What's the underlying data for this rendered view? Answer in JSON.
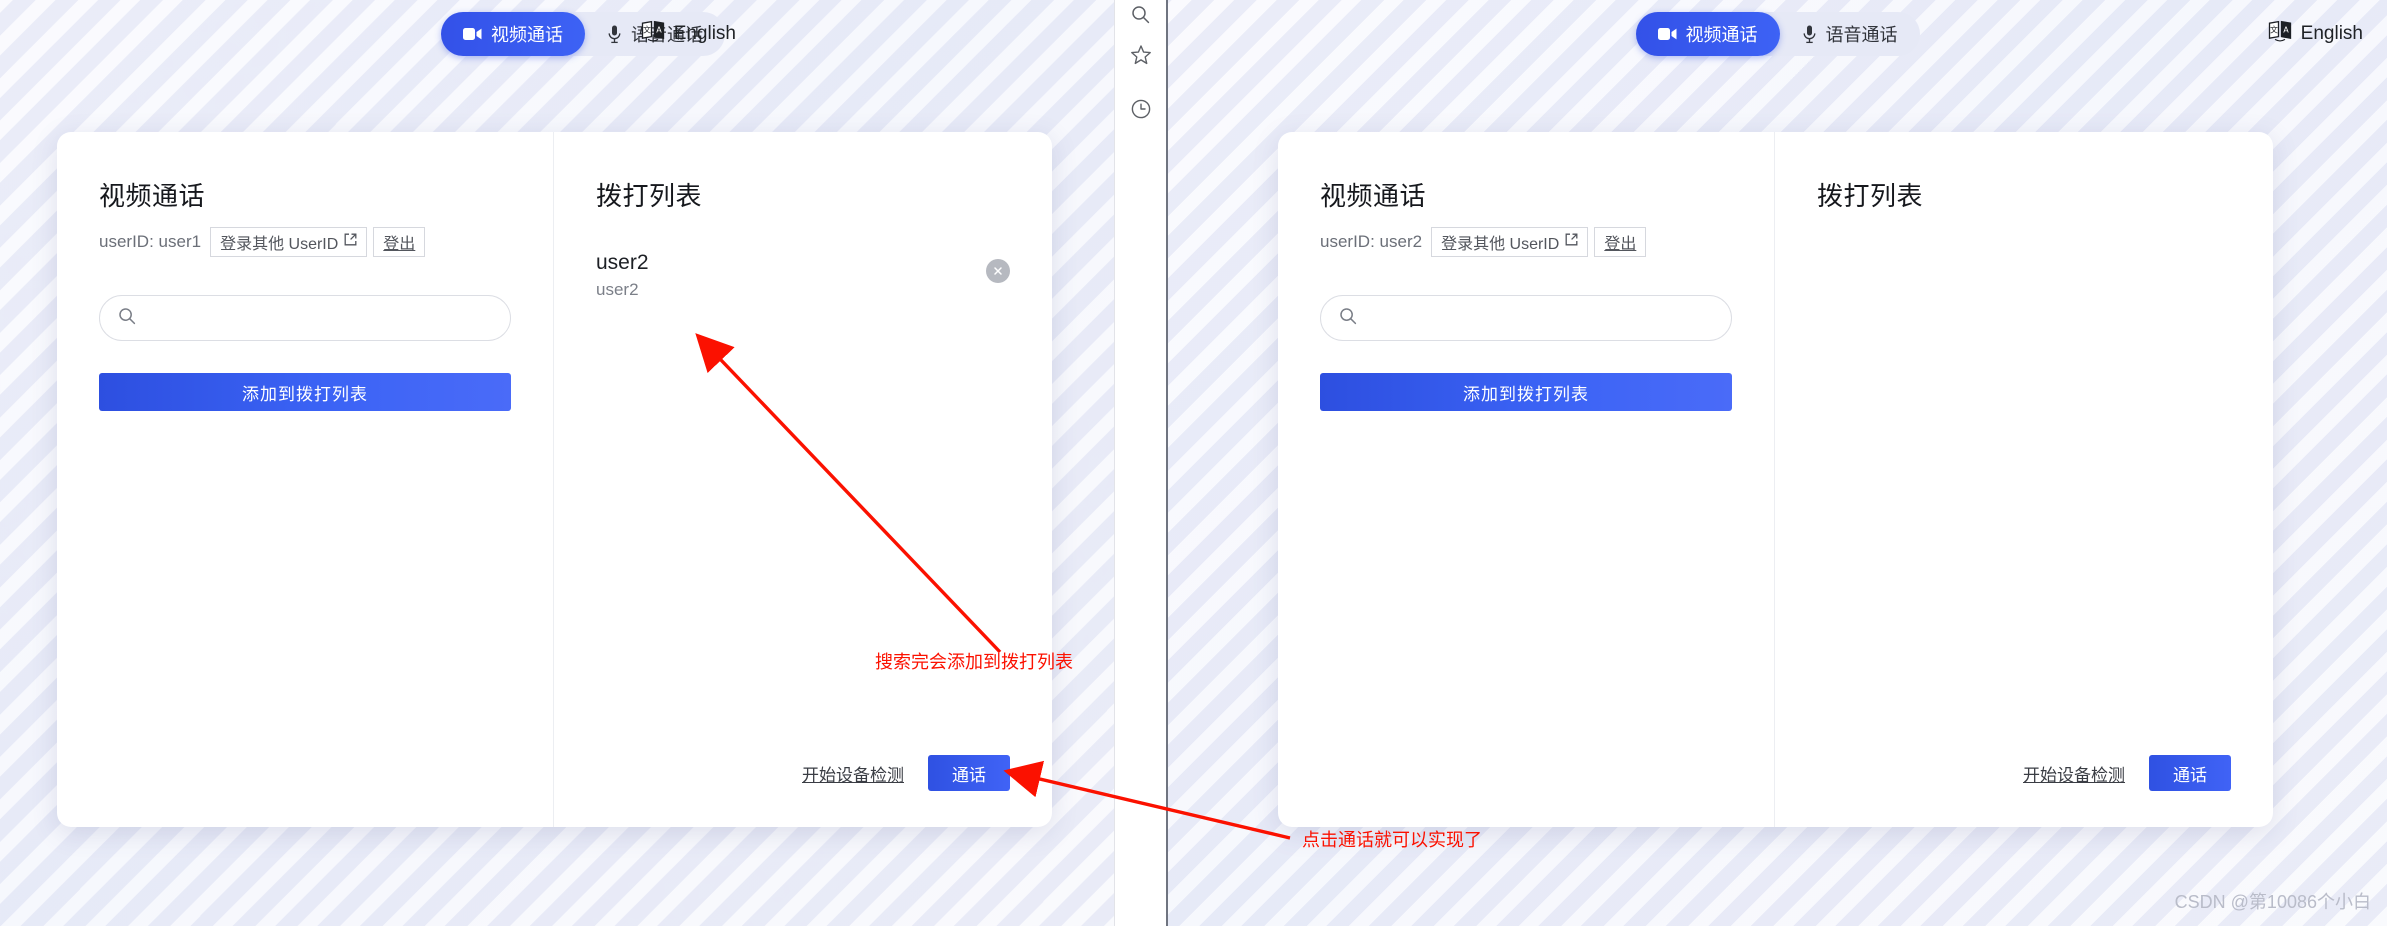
{
  "header": {
    "tabs": [
      {
        "label": "视频通话",
        "icon": "video-camera-icon",
        "active": true
      },
      {
        "label": "语音通话",
        "icon": "microphone-icon",
        "active": false
      }
    ],
    "language": {
      "label": "English",
      "icon": "translate-icon"
    }
  },
  "browser_rail": {
    "icons": [
      "search-icon",
      "star-icon",
      "history-clock-icon"
    ]
  },
  "left_window": {
    "call_panel": {
      "title": "视频通话",
      "user_prefix": "userID:",
      "user_id": "user1",
      "switch_user_label": "登录其他 UserID",
      "switch_user_icon": "external-link-icon",
      "logout_label": "登出",
      "search": {
        "value": "",
        "placeholder": "",
        "icon": "search-icon"
      },
      "add_button_label": "添加到拨打列表"
    },
    "dial_panel": {
      "title": "拨打列表",
      "items": [
        {
          "name": "user2",
          "sub": "user2",
          "remove_icon": "close-circle-icon"
        }
      ],
      "device_test_label": "开始设备检测",
      "call_button_label": "通话"
    }
  },
  "right_window": {
    "call_panel": {
      "title": "视频通话",
      "user_prefix": "userID:",
      "user_id": "user2",
      "switch_user_label": "登录其他 UserID",
      "switch_user_icon": "external-link-icon",
      "logout_label": "登出",
      "search": {
        "value": "",
        "placeholder": "",
        "icon": "search-icon"
      },
      "add_button_label": "添加到拨打列表"
    },
    "dial_panel": {
      "title": "拨打列表",
      "items": [],
      "device_test_label": "开始设备检测",
      "call_button_label": "通话"
    }
  },
  "annotations": {
    "note_search": "搜索完会添加到拨打列表",
    "note_call": "点击通话就可以实现了",
    "arrow_color": "#fb1100"
  },
  "watermark": "CSDN @第10086个小白",
  "colors": {
    "accent": "#3b63f5",
    "accent_dark": "#2d4fe0",
    "annotation_red": "#fb1100",
    "page_bg": "#eef0fa"
  }
}
